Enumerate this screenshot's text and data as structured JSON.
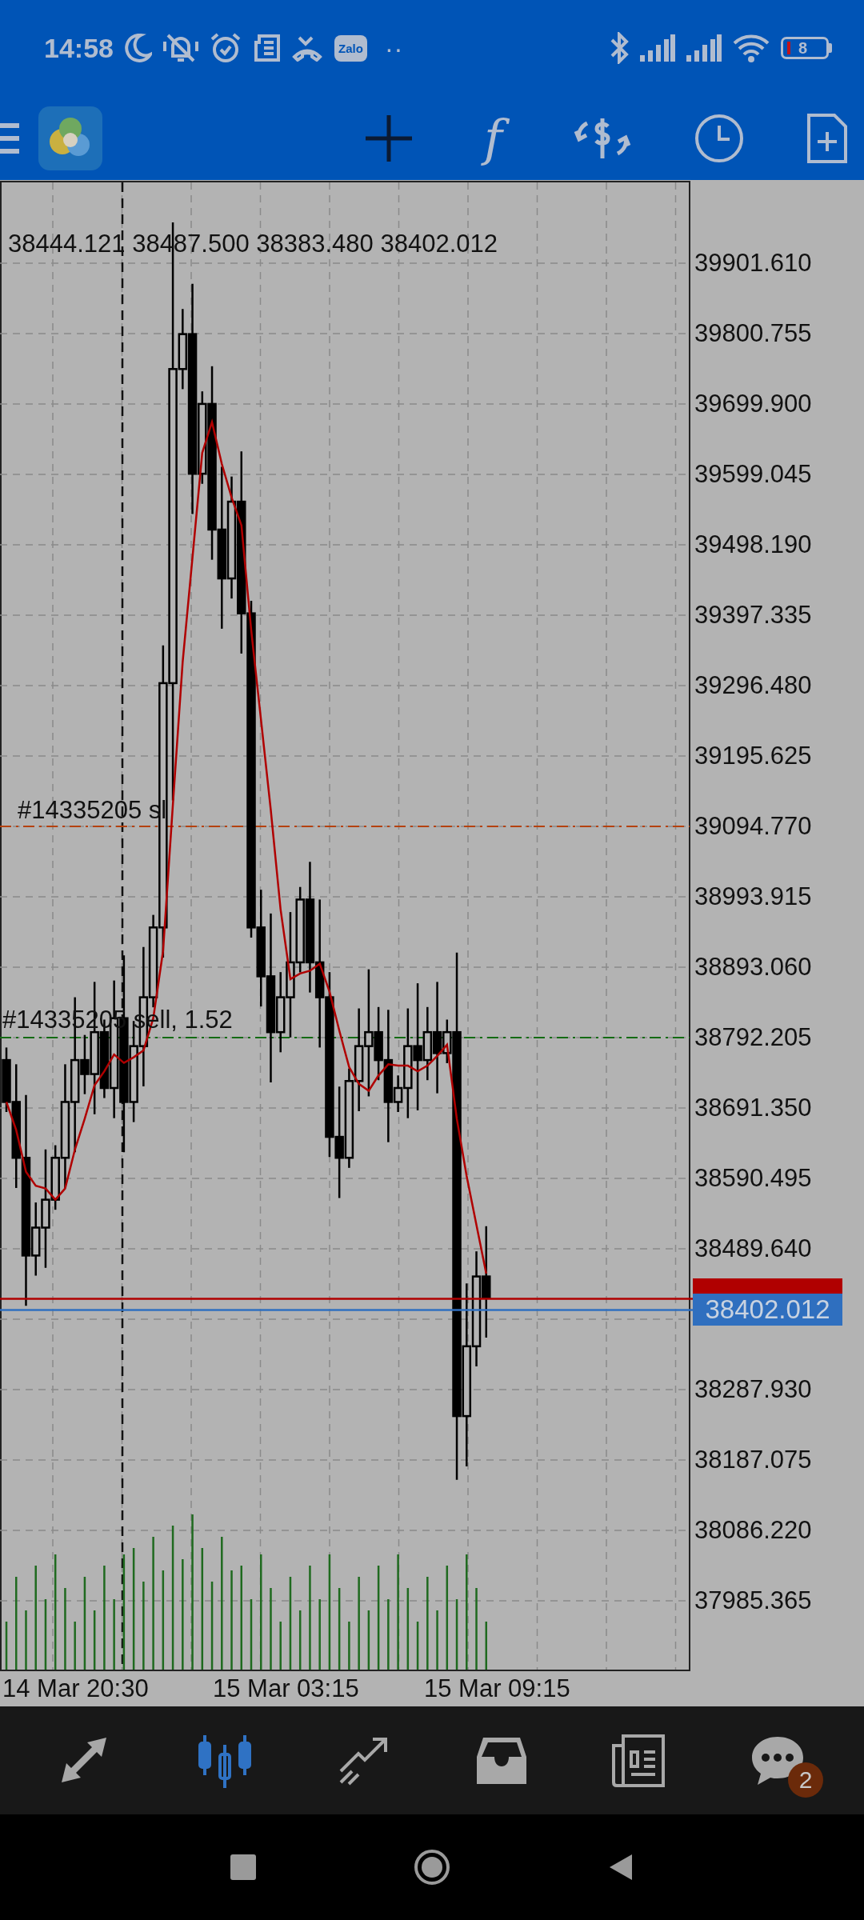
{
  "status_bar": {
    "time": "14:58",
    "app_badge": "Zalo",
    "more": "··",
    "battery": "8"
  },
  "toolbar": {
    "tools": [
      {
        "kind": "crosshair",
        "active": true
      },
      {
        "kind": "indicators",
        "glyph": "f",
        "active": false
      },
      {
        "kind": "symbols",
        "active": false
      },
      {
        "kind": "timeframe",
        "active": false
      },
      {
        "kind": "new-order",
        "active": false
      }
    ]
  },
  "chart": {
    "ohlc": "38444.121 38487.500 38383.480 38402.012",
    "order_labels": [
      "#14335205 sl",
      "#14335205 sell, 1.52"
    ],
    "price_axis": [
      "39901.610",
      "39800.755",
      "39699.900",
      "39599.045",
      "39498.190",
      "39397.335",
      "39296.480",
      "39195.625",
      "39094.770",
      "38993.915",
      "38893.060",
      "38792.205",
      "38691.350",
      "38590.495",
      "38489.640",
      "38287.930",
      "38187.075",
      "38086.220",
      "37985.365"
    ],
    "current_price": "38402.012",
    "time_axis": [
      "14 Mar 20:30",
      "15 Mar 03:15",
      "15 Mar 09:15"
    ]
  },
  "bottom_nav": [
    {
      "kind": "trade",
      "selected": false
    },
    {
      "kind": "chart",
      "selected": true
    },
    {
      "kind": "history",
      "selected": false
    },
    {
      "kind": "inbox",
      "selected": false
    },
    {
      "kind": "news",
      "selected": false
    },
    {
      "kind": "chat",
      "selected": false,
      "badge": "2"
    }
  ]
}
